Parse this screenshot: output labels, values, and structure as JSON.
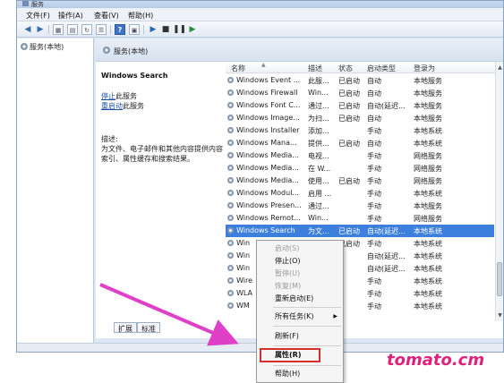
{
  "window": {
    "title": "服务"
  },
  "menubar": {
    "items": [
      "文件(F)",
      "操作(A)",
      "查看(V)",
      "帮助(H)"
    ]
  },
  "toolbar": {
    "buttons": [
      "back-icon",
      "forward-icon",
      "console-tree-icon",
      "export-icon",
      "refresh-icon",
      "list-icon",
      "help-icon",
      "properties-icon",
      "play-icon",
      "stop-icon",
      "pause-icon",
      "resume-icon"
    ]
  },
  "tree": {
    "root_label": "服务(本地)"
  },
  "main": {
    "header": "服务(本地)"
  },
  "desc": {
    "title": "Windows Search",
    "stop_link": "停止",
    "stop_suffix": "此服务",
    "restart_link": "重启动",
    "restart_suffix": "此服务",
    "label": "描述:",
    "text": "为文件、电子邮件和其他内容提供内容索引、属性缓存和搜索结果。"
  },
  "list": {
    "columns": [
      "名称",
      "描述",
      "状态",
      "启动类型",
      "登录为"
    ],
    "rows": [
      {
        "name": "Windows Event ...",
        "desc": "此服...",
        "status": "已启动",
        "startup": "自动",
        "logon": "本地服务"
      },
      {
        "name": "Windows Firewall",
        "desc": "Win...",
        "status": "已启动",
        "startup": "自动",
        "logon": "本地服务"
      },
      {
        "name": "Windows Font C...",
        "desc": "通过...",
        "status": "已启动",
        "startup": "自动(延迟...",
        "logon": "本地服务"
      },
      {
        "name": "Windows Image...",
        "desc": "为扫...",
        "status": "已启动",
        "startup": "自动",
        "logon": "本地服务"
      },
      {
        "name": "Windows Installer",
        "desc": "添加...",
        "status": "",
        "startup": "手动",
        "logon": "本地系统"
      },
      {
        "name": "Windows Mana...",
        "desc": "提供...",
        "status": "已启动",
        "startup": "自动",
        "logon": "本地系统"
      },
      {
        "name": "Windows Media...",
        "desc": "电视...",
        "status": "",
        "startup": "手动",
        "logon": "网络服务"
      },
      {
        "name": "Windows Media...",
        "desc": "在 W...",
        "status": "",
        "startup": "手动",
        "logon": "网络服务"
      },
      {
        "name": "Windows Media...",
        "desc": "使用...",
        "status": "已启动",
        "startup": "手动",
        "logon": "网络服务"
      },
      {
        "name": "Windows Modul...",
        "desc": "启用 ...",
        "status": "",
        "startup": "手动",
        "logon": "本地系统"
      },
      {
        "name": "Windows Presen...",
        "desc": "通过...",
        "status": "",
        "startup": "手动",
        "logon": "本地服务"
      },
      {
        "name": "Windows Remot...",
        "desc": "Win...",
        "status": "",
        "startup": "手动",
        "logon": "网络服务"
      },
      {
        "name": "Windows Search",
        "desc": "为文...",
        "status": "已启动",
        "startup": "自动(延迟...",
        "logon": "本地系统"
      },
      {
        "name": "Win",
        "desc": "",
        "status": "已启动",
        "startup": "手动",
        "logon": "本地系统"
      },
      {
        "name": "Win",
        "desc": "",
        "status": "",
        "startup": "自动(延迟...",
        "logon": "本地系统"
      },
      {
        "name": "Win",
        "desc": "",
        "status": "",
        "startup": "自动(延迟...",
        "logon": "本地系统"
      },
      {
        "name": "Wire",
        "desc": "",
        "status": "",
        "startup": "手动",
        "logon": "本地系统"
      },
      {
        "name": "WLA",
        "desc": "",
        "status": "",
        "startup": "手动",
        "logon": "本地系统"
      },
      {
        "name": "WM",
        "desc": "",
        "status": "",
        "startup": "手动",
        "logon": "本地系统"
      }
    ]
  },
  "context_menu": {
    "items": [
      {
        "label": "启动(S)",
        "disabled": true
      },
      {
        "label": "停止(O)",
        "disabled": false
      },
      {
        "label": "暂停(U)",
        "disabled": true
      },
      {
        "label": "恢复(M)",
        "disabled": true
      },
      {
        "label": "重新启动(E)",
        "disabled": false
      },
      {
        "label": "所有任务(K)",
        "disabled": false
      },
      {
        "label": "刷新(F)",
        "disabled": false
      },
      {
        "label": "属性(R)",
        "disabled": false
      },
      {
        "label": "帮助(H)",
        "disabled": false
      }
    ]
  },
  "tabs": [
    "扩展",
    "标准"
  ],
  "watermark": "tomato.cm",
  "colors": {
    "selection": "#3c7fdc",
    "highlight_box": "#d32f2f",
    "arrow": "#e040c8",
    "watermark": "#e0207d"
  }
}
